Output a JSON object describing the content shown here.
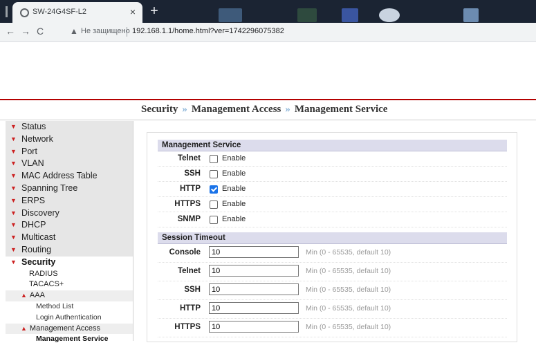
{
  "browser": {
    "tab_title": "SW-24G4SF-L2",
    "tab_close": "×",
    "new_tab": "+",
    "not_secure": "Не защищено",
    "url": "192.168.1.1/home.html?ver=1742296075382"
  },
  "breadcrumb": [
    "Security",
    "Management Access",
    "Management Service"
  ],
  "breadcrumb_separator": "»",
  "sidebar": {
    "items": [
      {
        "label": "Status"
      },
      {
        "label": "Network"
      },
      {
        "label": "Port"
      },
      {
        "label": "VLAN"
      },
      {
        "label": "MAC Address Table"
      },
      {
        "label": "Spanning Tree"
      },
      {
        "label": "ERPS"
      },
      {
        "label": "Discovery"
      },
      {
        "label": "DHCP"
      },
      {
        "label": "Multicast"
      },
      {
        "label": "Routing"
      },
      {
        "label": "Security"
      }
    ],
    "security_sub": {
      "radius": "RADIUS",
      "tacacs": "TACACS+",
      "aaa": "AAA",
      "method_list": "Method List",
      "login_auth": "Login Authentication",
      "mgmt_access": "Management Access",
      "mgmt_service": "Management Service"
    }
  },
  "management_service": {
    "title": "Management Service",
    "enable_label": "Enable",
    "rows": [
      {
        "label": "Telnet",
        "checked": false
      },
      {
        "label": "SSH",
        "checked": false
      },
      {
        "label": "HTTP",
        "checked": true
      },
      {
        "label": "HTTPS",
        "checked": false
      },
      {
        "label": "SNMP",
        "checked": false
      }
    ]
  },
  "session_timeout": {
    "title": "Session Timeout",
    "hint": "Min (0 - 65535, default 10)",
    "rows": [
      {
        "label": "Console",
        "value": "10"
      },
      {
        "label": "Telnet",
        "value": "10"
      },
      {
        "label": "SSH",
        "value": "10"
      },
      {
        "label": "HTTP",
        "value": "10"
      },
      {
        "label": "HTTPS",
        "value": "10"
      }
    ]
  },
  "colors": {
    "accent_red": "#b40000",
    "checkbox_blue": "#1a73e8",
    "section_head": "#dcdcec"
  }
}
